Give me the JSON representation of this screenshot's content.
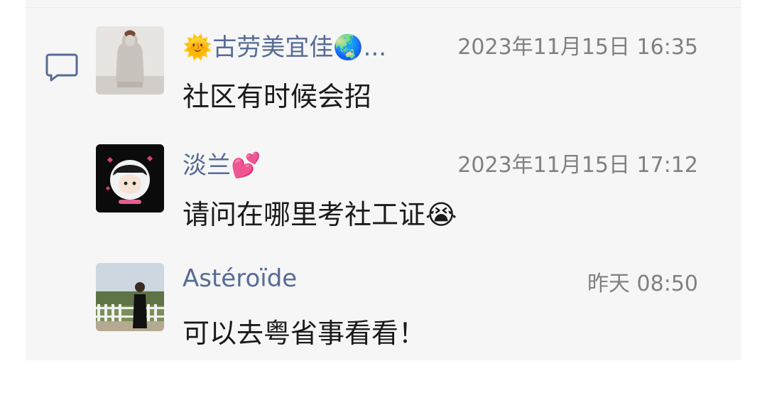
{
  "comments": [
    {
      "name": "🌞古劳美宜佳🌏...",
      "time": "2023年11月15日 16:35",
      "message": "社区有时候会招",
      "avatar_icon": "statue-avatar"
    },
    {
      "name": "淡兰💕",
      "time": "2023年11月15日 17:12",
      "message": "请问在哪里考社工证😭",
      "avatar_icon": "cartoon-avatar"
    },
    {
      "name": "Astéroïde",
      "time": "昨天 08:50",
      "message": "可以去粤省事看看！",
      "avatar_icon": "photo-avatar"
    }
  ],
  "colors": {
    "name": "#576b95",
    "time": "#808080",
    "message": "#1a1a1a",
    "panel": "#f6f6f7"
  }
}
